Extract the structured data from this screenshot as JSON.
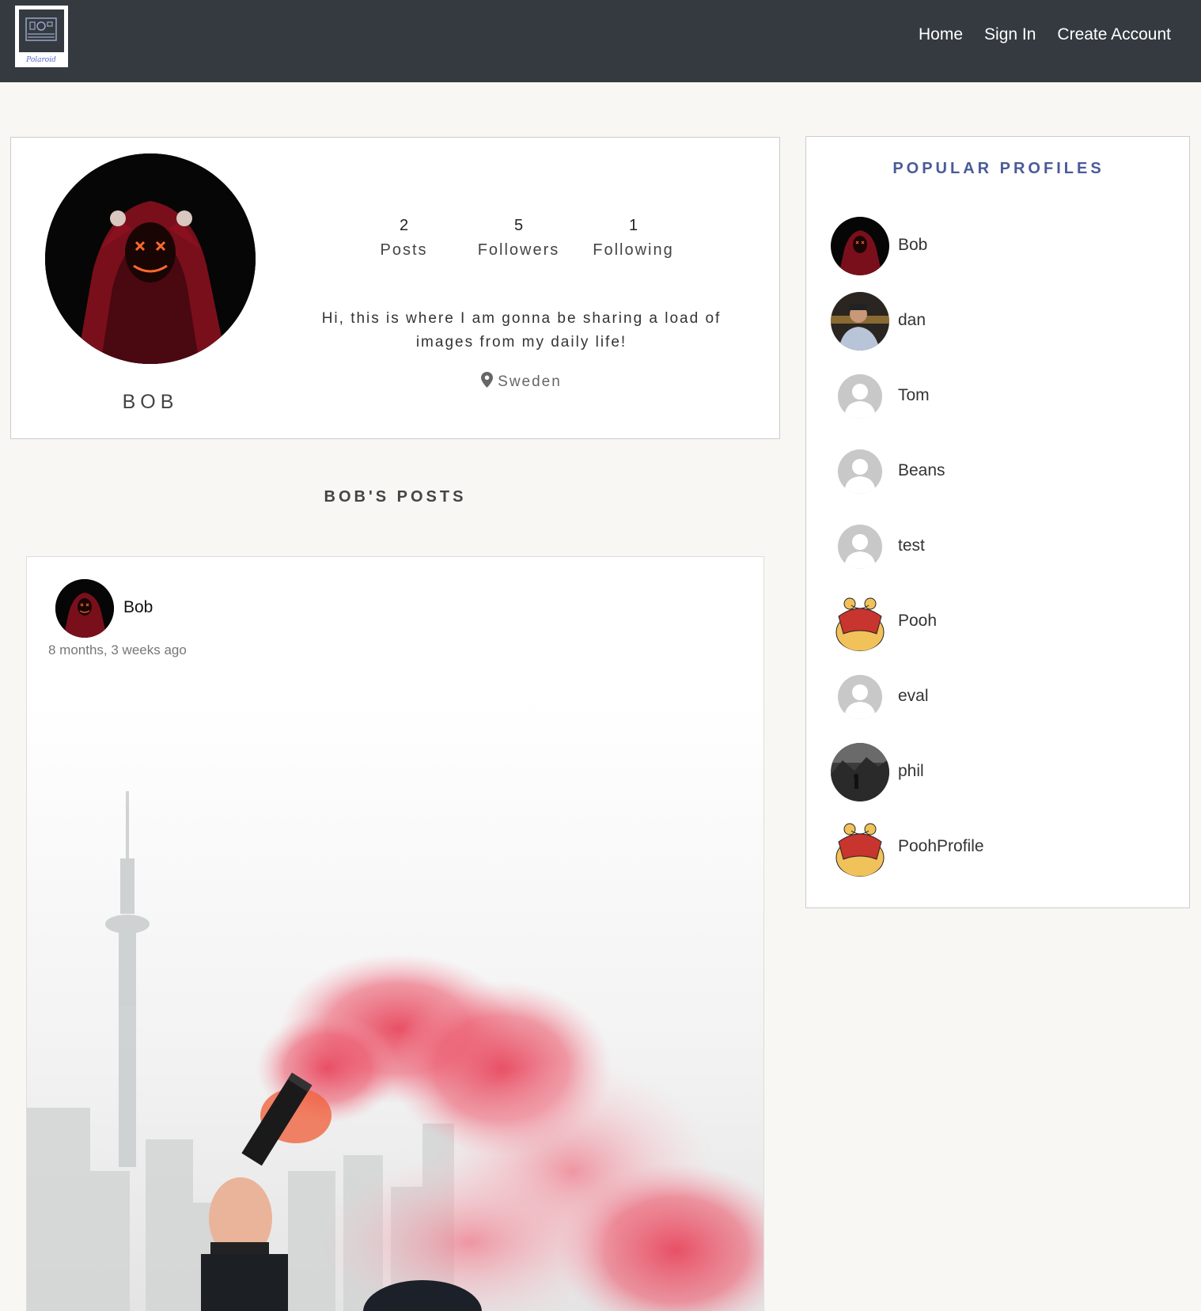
{
  "nav": {
    "logo_text": "Polaroid",
    "links": [
      "Home",
      "Sign In",
      "Create Account"
    ]
  },
  "profile": {
    "name": "BOB",
    "stats": [
      {
        "value": "2",
        "label": "Posts"
      },
      {
        "value": "5",
        "label": "Followers"
      },
      {
        "value": "1",
        "label": "Following"
      }
    ],
    "bio": "Hi, this is where I am gonna be sharing a load of images from my daily life!",
    "location": "Sweden"
  },
  "posts_heading": "BOB'S POSTS",
  "post": {
    "author": "Bob",
    "time": "8 months, 3 weeks ago"
  },
  "popular": {
    "title": "POPULAR PROFILES",
    "profiles": [
      {
        "name": "Bob",
        "avatar": "mask-avatar"
      },
      {
        "name": "dan",
        "avatar": "photo-avatar"
      },
      {
        "name": "Tom",
        "avatar": "default-avatar"
      },
      {
        "name": "Beans",
        "avatar": "default-avatar"
      },
      {
        "name": "test",
        "avatar": "default-avatar"
      },
      {
        "name": "Pooh",
        "avatar": "pooh-avatar"
      },
      {
        "name": "eval",
        "avatar": "default-avatar"
      },
      {
        "name": "phil",
        "avatar": "photo-avatar"
      },
      {
        "name": "PoohProfile",
        "avatar": "pooh-avatar"
      }
    ]
  },
  "colors": {
    "navbar": "#343a40",
    "background": "#f8f7f4",
    "accent": "#4a5a9a",
    "smoke": "#e8485e"
  }
}
